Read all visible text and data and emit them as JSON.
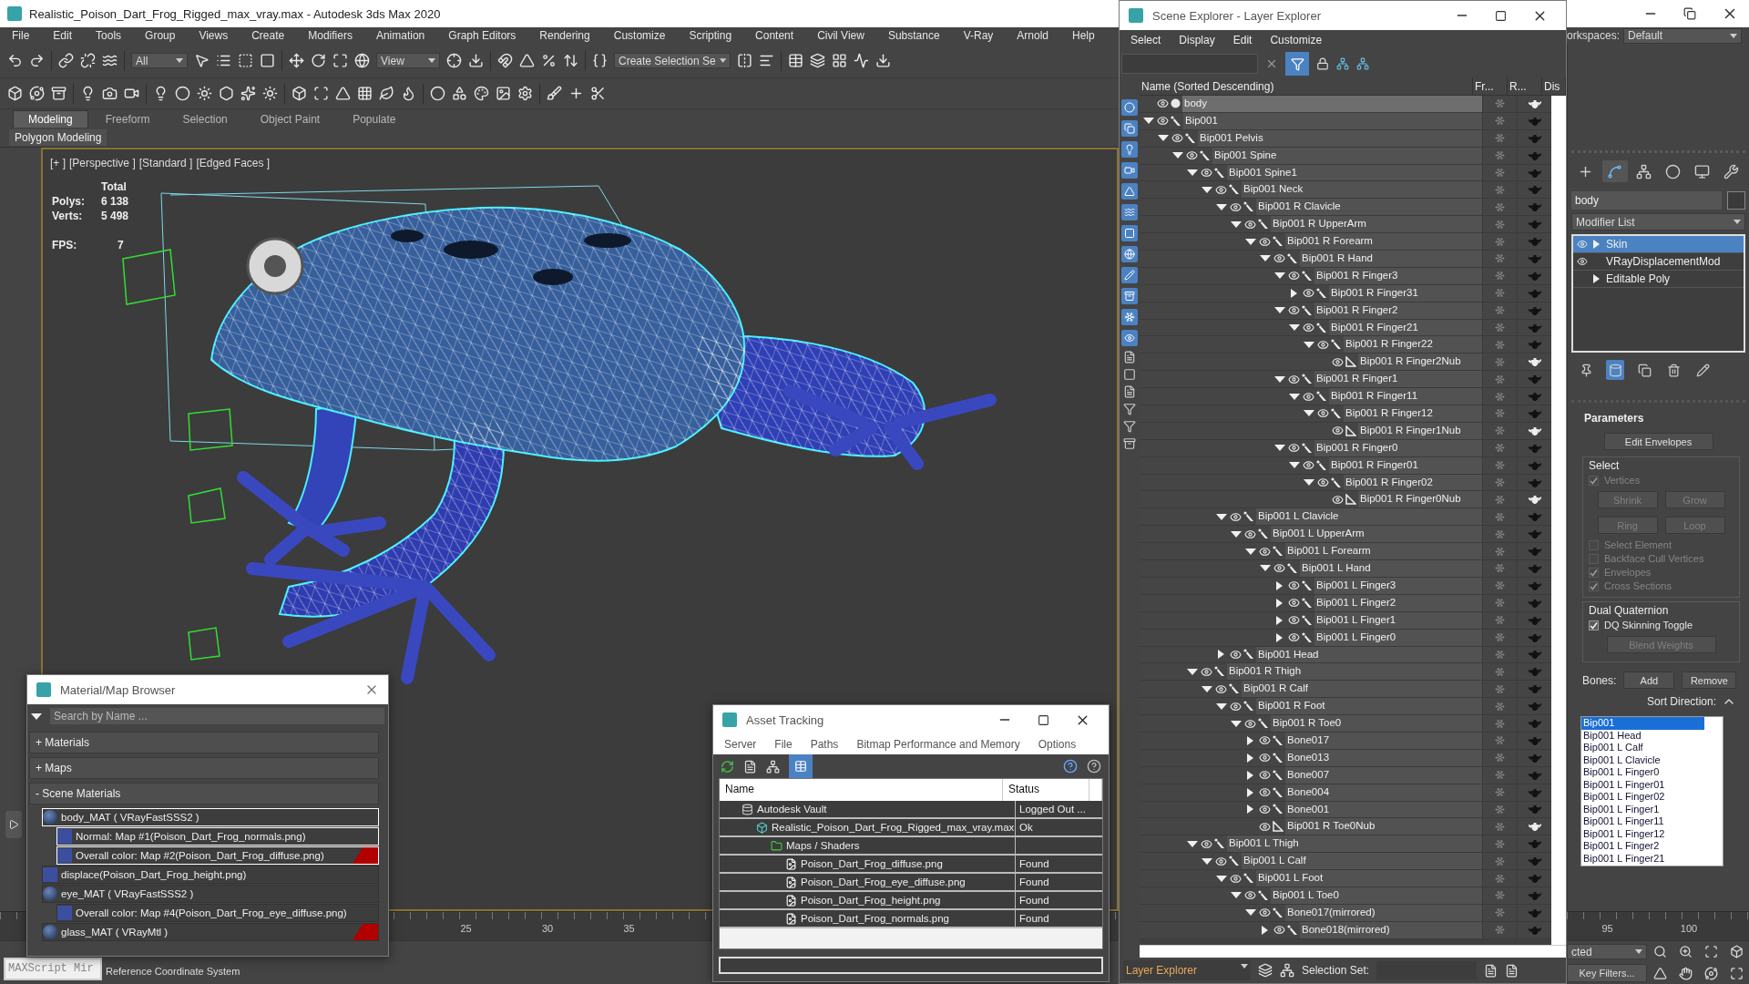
{
  "title_bar": {
    "title": "Realistic_Poison_Dart_Frog_Rigged_max_vray.max - Autodesk 3ds Max 2020"
  },
  "menu": [
    "File",
    "Edit",
    "Tools",
    "Group",
    "Views",
    "Create",
    "Modifiers",
    "Animation",
    "Graph Editors",
    "Rendering",
    "Customize",
    "Scripting",
    "Content",
    "Civil View",
    "Substance",
    "V-Ray",
    "Arnold",
    "Help"
  ],
  "workspaces": {
    "label": "orkspaces:",
    "value": "Default"
  },
  "toolbar": {
    "filter": "All",
    "coordinate": "View",
    "selection_set": "Create Selection Se"
  },
  "ribbon_tabs": [
    {
      "label": "Modeling",
      "selected": true
    },
    {
      "label": "Freeform",
      "selected": false
    },
    {
      "label": "Selection",
      "selected": false
    },
    {
      "label": "Object Paint",
      "selected": false
    },
    {
      "label": "Populate",
      "selected": false
    }
  ],
  "ribbon_panel": "Polygon Modeling",
  "viewport": {
    "labels": [
      "[+ ]",
      "[Perspective ]",
      "[Standard ]",
      "[Edged Faces ]"
    ],
    "stats_heading": "Total",
    "stats": [
      {
        "label": "Polys:",
        "value": "6 138"
      },
      {
        "label": "Verts:",
        "value": "5 498"
      }
    ],
    "fps_label": "FPS:",
    "fps": "7"
  },
  "command_panel": {
    "tabs": [
      {
        "selected": false
      },
      {
        "selected": true
      },
      {
        "selected": false
      },
      {
        "selected": false
      },
      {
        "selected": false
      },
      {
        "selected": false
      }
    ],
    "object_name": "body",
    "modifier_list": "Modifier List",
    "stack": [
      {
        "name": "Skin",
        "eye": true,
        "expandable": true,
        "selected": true
      },
      {
        "name": "VRayDisplacementMod",
        "eye": true,
        "expandable": false,
        "selected": false
      },
      {
        "name": "Editable Poly",
        "eye": false,
        "expandable": true,
        "selected": false
      }
    ],
    "stack_tools": [
      {
        "selected": false
      },
      {
        "selected": true
      },
      {
        "selected": false
      },
      {
        "selected": false
      },
      {
        "selected": false
      }
    ],
    "rollout": "Parameters",
    "edit_envelopes": "Edit Envelopes",
    "groups": [
      {
        "title": "Select",
        "controls": [
          {
            "kind": "check",
            "label": "Vertices",
            "checked": true,
            "disabled": true
          },
          {
            "kind": "buttons",
            "buttons": [
              {
                "label": "Shrink",
                "disabled": true
              },
              {
                "label": "Grow",
                "disabled": true
              }
            ]
          },
          {
            "kind": "buttons",
            "buttons": [
              {
                "label": "Ring",
                "disabled": true
              },
              {
                "label": "Loop",
                "disabled": true
              }
            ]
          },
          {
            "kind": "check",
            "label": "Select Element",
            "checked": false,
            "disabled": true
          },
          {
            "kind": "check",
            "label": "Backface Cull Vertices",
            "checked": false,
            "disabled": true
          },
          {
            "kind": "check",
            "label": "Envelopes",
            "checked": true,
            "disabled": true
          },
          {
            "kind": "check",
            "label": "Cross Sections",
            "checked": true,
            "disabled": true
          }
        ]
      },
      {
        "title": "Dual Quaternion",
        "controls": [
          {
            "kind": "check",
            "label": "DQ Skinning Toggle",
            "checked": true,
            "disabled": false
          },
          {
            "kind": "buttons",
            "buttons": [
              {
                "label": "Blend Weights",
                "disabled": true
              }
            ]
          }
        ]
      }
    ],
    "bones": {
      "label": "Bones:",
      "add": "Add",
      "remove": "Remove",
      "sort_label": "Sort Direction:",
      "list": [
        {
          "name": "Bip001",
          "selected": true
        },
        {
          "name": "Bip001 Head",
          "selected": false
        },
        {
          "name": "Bip001 L Calf",
          "selected": false
        },
        {
          "name": "Bip001 L Clavicle",
          "selected": false
        },
        {
          "name": "Bip001 L Finger0",
          "selected": false
        },
        {
          "name": "Bip001 L Finger01",
          "selected": false
        },
        {
          "name": "Bip001 L Finger02",
          "selected": false
        },
        {
          "name": "Bip001 L Finger1",
          "selected": false
        },
        {
          "name": "Bip001 L Finger11",
          "selected": false
        },
        {
          "name": "Bip001 L Finger12",
          "selected": false
        },
        {
          "name": "Bip001 L Finger2",
          "selected": false
        },
        {
          "name": "Bip001 L Finger21",
          "selected": false
        }
      ]
    }
  },
  "timeline": [
    "25",
    "30",
    "35",
    "95",
    "100"
  ],
  "status": {
    "script_field": "MAXScript Mir",
    "prompt": "Reference Coordinate System",
    "selection_filter": "cted",
    "key_filters": "Key Filters..."
  },
  "scene_explorer": {
    "title": "Scene Explorer - Layer Explorer",
    "menu": [
      "Select",
      "Display",
      "Edit",
      "Customize"
    ],
    "columns": [
      "Name (Sorted Descending)",
      "Fr...",
      "R...",
      "Dis"
    ],
    "tree": [
      {
        "name": "body",
        "kind": "mesh",
        "selected": true
      },
      {
        "name": "Bip001",
        "kind": "bone",
        "selected": false,
        "expanded": true,
        "children": [
          {
            "name": "Bip001 Pelvis",
            "kind": "bone",
            "selected": false,
            "expanded": true,
            "children": [
              {
                "name": "Bip001 Spine",
                "kind": "bone",
                "selected": false,
                "expanded": true,
                "children": [
                  {
                    "name": "Bip001 Spine1",
                    "kind": "bone",
                    "selected": false,
                    "expanded": true,
                    "children": [
                      {
                        "name": "Bip001 Neck",
                        "kind": "bone",
                        "selected": false,
                        "expanded": true,
                        "children": [
                          {
                            "name": "Bip001 R Clavicle",
                            "kind": "bone",
                            "selected": false,
                            "expanded": true,
                            "children": [
                              {
                                "name": "Bip001 R UpperArm",
                                "kind": "bone",
                                "selected": false,
                                "expanded": true,
                                "children": [
                                  {
                                    "name": "Bip001 R Forearm",
                                    "kind": "bone",
                                    "selected": false,
                                    "expanded": true,
                                    "children": [
                                      {
                                        "name": "Bip001 R Hand",
                                        "kind": "bone",
                                        "selected": false,
                                        "expanded": true,
                                        "children": [
                                          {
                                            "name": "Bip001 R Finger3",
                                            "kind": "bone",
                                            "selected": false,
                                            "expanded": true,
                                            "children": [
                                              {
                                                "name": "Bip001 R Finger31",
                                                "kind": "bone",
                                                "selected": false,
                                                "expanded": false
                                              }
                                            ]
                                          },
                                          {
                                            "name": "Bip001 R Finger2",
                                            "kind": "bone",
                                            "selected": false,
                                            "expanded": true,
                                            "children": [
                                              {
                                                "name": "Bip001 R Finger21",
                                                "kind": "bone",
                                                "selected": false,
                                                "expanded": true,
                                                "children": [
                                                  {
                                                    "name": "Bip001 R Finger22",
                                                    "kind": "bone",
                                                    "selected": false,
                                                    "expanded": true,
                                                    "children": [
                                                      {
                                                        "name": "Bip001 R Finger2Nub",
                                                        "kind": "nub",
                                                        "selected": false
                                                      }
                                                    ]
                                                  }
                                                ]
                                              }
                                            ]
                                          },
                                          {
                                            "name": "Bip001 R Finger1",
                                            "kind": "bone",
                                            "selected": false,
                                            "expanded": true,
                                            "children": [
                                              {
                                                "name": "Bip001 R Finger11",
                                                "kind": "bone",
                                                "selected": false,
                                                "expanded": true,
                                                "children": [
                                                  {
                                                    "name": "Bip001 R Finger12",
                                                    "kind": "bone",
                                                    "selected": false,
                                                    "expanded": true,
                                                    "children": [
                                                      {
                                                        "name": "Bip001 R Finger1Nub",
                                                        "kind": "nub",
                                                        "selected": false
                                                      }
                                                    ]
                                                  }
                                                ]
                                              }
                                            ]
                                          },
                                          {
                                            "name": "Bip001 R Finger0",
                                            "kind": "bone",
                                            "selected": false,
                                            "expanded": true,
                                            "children": [
                                              {
                                                "name": "Bip001 R Finger01",
                                                "kind": "bone",
                                                "selected": false,
                                                "expanded": true,
                                                "children": [
                                                  {
                                                    "name": "Bip001 R Finger02",
                                                    "kind": "bone",
                                                    "selected": false,
                                                    "expanded": true,
                                                    "children": [
                                                      {
                                                        "name": "Bip001 R Finger0Nub",
                                                        "kind": "nub",
                                                        "selected": false
                                                      }
                                                    ]
                                                  }
                                                ]
                                              }
                                            ]
                                          }
                                        ]
                                      }
                                    ]
                                  }
                                ]
                              }
                            ]
                          },
                          {
                            "name": "Bip001 L Clavicle",
                            "kind": "bone",
                            "selected": false,
                            "expanded": true,
                            "children": [
                              {
                                "name": "Bip001 L UpperArm",
                                "kind": "bone",
                                "selected": false,
                                "expanded": true,
                                "children": [
                                  {
                                    "name": "Bip001 L Forearm",
                                    "kind": "bone",
                                    "selected": false,
                                    "expanded": true,
                                    "children": [
                                      {
                                        "name": "Bip001 L Hand",
                                        "kind": "bone",
                                        "selected": false,
                                        "expanded": true,
                                        "children": [
                                          {
                                            "name": "Bip001 L Finger3",
                                            "kind": "bone",
                                            "selected": false,
                                            "expanded": false
                                          },
                                          {
                                            "name": "Bip001 L Finger2",
                                            "kind": "bone",
                                            "selected": false,
                                            "expanded": false
                                          },
                                          {
                                            "name": "Bip001 L Finger1",
                                            "kind": "bone",
                                            "selected": false,
                                            "expanded": false
                                          },
                                          {
                                            "name": "Bip001 L Finger0",
                                            "kind": "bone",
                                            "selected": false,
                                            "expanded": false
                                          }
                                        ]
                                      }
                                    ]
                                  }
                                ]
                              }
                            ]
                          },
                          {
                            "name": "Bip001 Head",
                            "kind": "bone",
                            "selected": false,
                            "expanded": false
                          }
                        ]
                      }
                    ]
                  },
                  {
                    "name": "Bip001 R Thigh",
                    "kind": "bone",
                    "selected": false,
                    "expanded": true,
                    "children": [
                      {
                        "name": "Bip001 R Calf",
                        "kind": "bone",
                        "selected": false,
                        "expanded": true,
                        "children": [
                          {
                            "name": "Bip001 R Foot",
                            "kind": "bone",
                            "selected": false,
                            "expanded": true,
                            "children": [
                              {
                                "name": "Bip001 R Toe0",
                                "kind": "bone",
                                "selected": false,
                                "expanded": true,
                                "children": [
                                  {
                                    "name": "Bone017",
                                    "kind": "bone",
                                    "selected": false,
                                    "expanded": false
                                  },
                                  {
                                    "name": "Bone013",
                                    "kind": "bone",
                                    "selected": false,
                                    "expanded": false
                                  },
                                  {
                                    "name": "Bone007",
                                    "kind": "bone",
                                    "selected": false,
                                    "expanded": false
                                  },
                                  {
                                    "name": "Bone004",
                                    "kind": "bone",
                                    "selected": false,
                                    "expanded": false
                                  },
                                  {
                                    "name": "Bone001",
                                    "kind": "bone",
                                    "selected": false,
                                    "expanded": false
                                  },
                                  {
                                    "name": "Bip001 R Toe0Nub",
                                    "kind": "nub",
                                    "selected": false
                                  }
                                ]
                              }
                            ]
                          }
                        ]
                      }
                    ]
                  },
                  {
                    "name": "Bip001 L Thigh",
                    "kind": "bone",
                    "selected": false,
                    "expanded": true,
                    "children": [
                      {
                        "name": "Bip001 L Calf",
                        "kind": "bone",
                        "selected": false,
                        "expanded": true,
                        "children": [
                          {
                            "name": "Bip001 L Foot",
                            "kind": "bone",
                            "selected": false,
                            "expanded": true,
                            "children": [
                              {
                                "name": "Bip001 L Toe0",
                                "kind": "bone",
                                "selected": false,
                                "expanded": true,
                                "children": [
                                  {
                                    "name": "Bone017(mirrored)",
                                    "kind": "bone",
                                    "selected": false,
                                    "expanded": true,
                                    "children": [
                                      {
                                        "name": "Bone018(mirrored)",
                                        "kind": "bone",
                                        "selected": false,
                                        "expanded": false
                                      }
                                    ]
                                  }
                                ]
                              }
                            ]
                          }
                        ]
                      }
                    ]
                  }
                ]
              }
            ]
          }
        ]
      }
    ],
    "footer_layer": "Layer Explorer",
    "selection_set_label": "Selection Set:"
  },
  "material_browser": {
    "title": "Material/Map Browser",
    "search_placeholder": "Search by Name ...",
    "sections": [
      "+ Materials",
      "+ Maps",
      "- Scene Materials"
    ],
    "items": [
      {
        "label": "body_MAT ( VRayFastSSS2 )",
        "kind": "material",
        "selected": true,
        "flagged": false,
        "children": [
          {
            "label": "Normal: Map #1(Poison_Dart_Frog_normals.png)",
            "kind": "map",
            "selected": true,
            "flagged": false
          },
          {
            "label": "Overall color: Map #2(Poison_Dart_Frog_diffuse.png)",
            "kind": "map",
            "selected": true,
            "flagged": true
          }
        ]
      },
      {
        "label": "displace(Poison_Dart_Frog_height.png)",
        "kind": "map",
        "selected": false,
        "flagged": false
      },
      {
        "label": "eye_MAT ( VRayFastSSS2 )",
        "kind": "material",
        "selected": false,
        "flagged": false,
        "children": [
          {
            "label": "Overall color: Map #4(Poison_Dart_Frog_eye_diffuse.png)",
            "kind": "map",
            "selected": false,
            "flagged": false
          }
        ]
      },
      {
        "label": "glass_MAT ( VRayMtl )",
        "kind": "material",
        "selected": false,
        "flagged": true
      }
    ]
  },
  "asset_tracking": {
    "title": "Asset Tracking",
    "menu": [
      "Server",
      "File",
      "Paths",
      "Bitmap Performance and Memory",
      "Options"
    ],
    "columns": [
      "Name",
      "Status"
    ],
    "rows": [
      {
        "name": "Autodesk Vault",
        "kind": "vault",
        "status": "Logged Out ...",
        "children": [
          {
            "name": "Realistic_Poison_Dart_Frog_Rigged_max_vray.max",
            "kind": "scene",
            "status": "Ok",
            "children": [
              {
                "name": "Maps / Shaders",
                "kind": "folder",
                "children": [
                  {
                    "name": "Poison_Dart_Frog_diffuse.png",
                    "kind": "image",
                    "status": "Found"
                  },
                  {
                    "name": "Poison_Dart_Frog_eye_diffuse.png",
                    "kind": "image",
                    "status": "Found"
                  },
                  {
                    "name": "Poison_Dart_Frog_height.png",
                    "kind": "image",
                    "status": "Found"
                  },
                  {
                    "name": "Poison_Dart_Frog_normals.png",
                    "kind": "image",
                    "status": "Found"
                  }
                ]
              }
            ]
          }
        ]
      }
    ]
  }
}
